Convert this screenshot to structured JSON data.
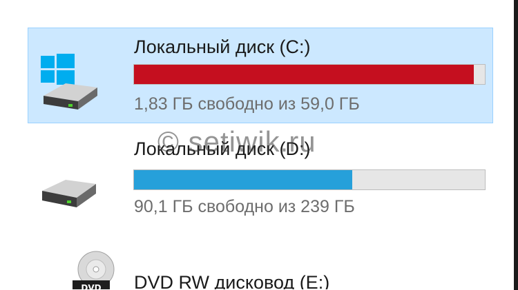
{
  "drives": [
    {
      "name": "Локальный диск (C:)",
      "free_text": "1,83 ГБ свободно из 59,0 ГБ",
      "used_fraction": 0.969,
      "bar_color": "#c50f1f",
      "selected": true,
      "icon": "windows-system-drive-icon"
    },
    {
      "name": "Локальный диск (D:)",
      "free_text": "90,1 ГБ свободно из 239 ГБ",
      "used_fraction": 0.623,
      "bar_color": "#26a0da",
      "selected": false,
      "icon": "hard-drive-icon"
    },
    {
      "name": "DVD RW дисковод (E:)",
      "icon": "dvd-drive-icon",
      "icon_label": "DVD"
    }
  ],
  "watermark": "© setiwik.ru",
  "colors": {
    "selection_bg": "#cce8ff",
    "selection_border": "#99d1ff",
    "bar_track": "#e6e6e6"
  }
}
